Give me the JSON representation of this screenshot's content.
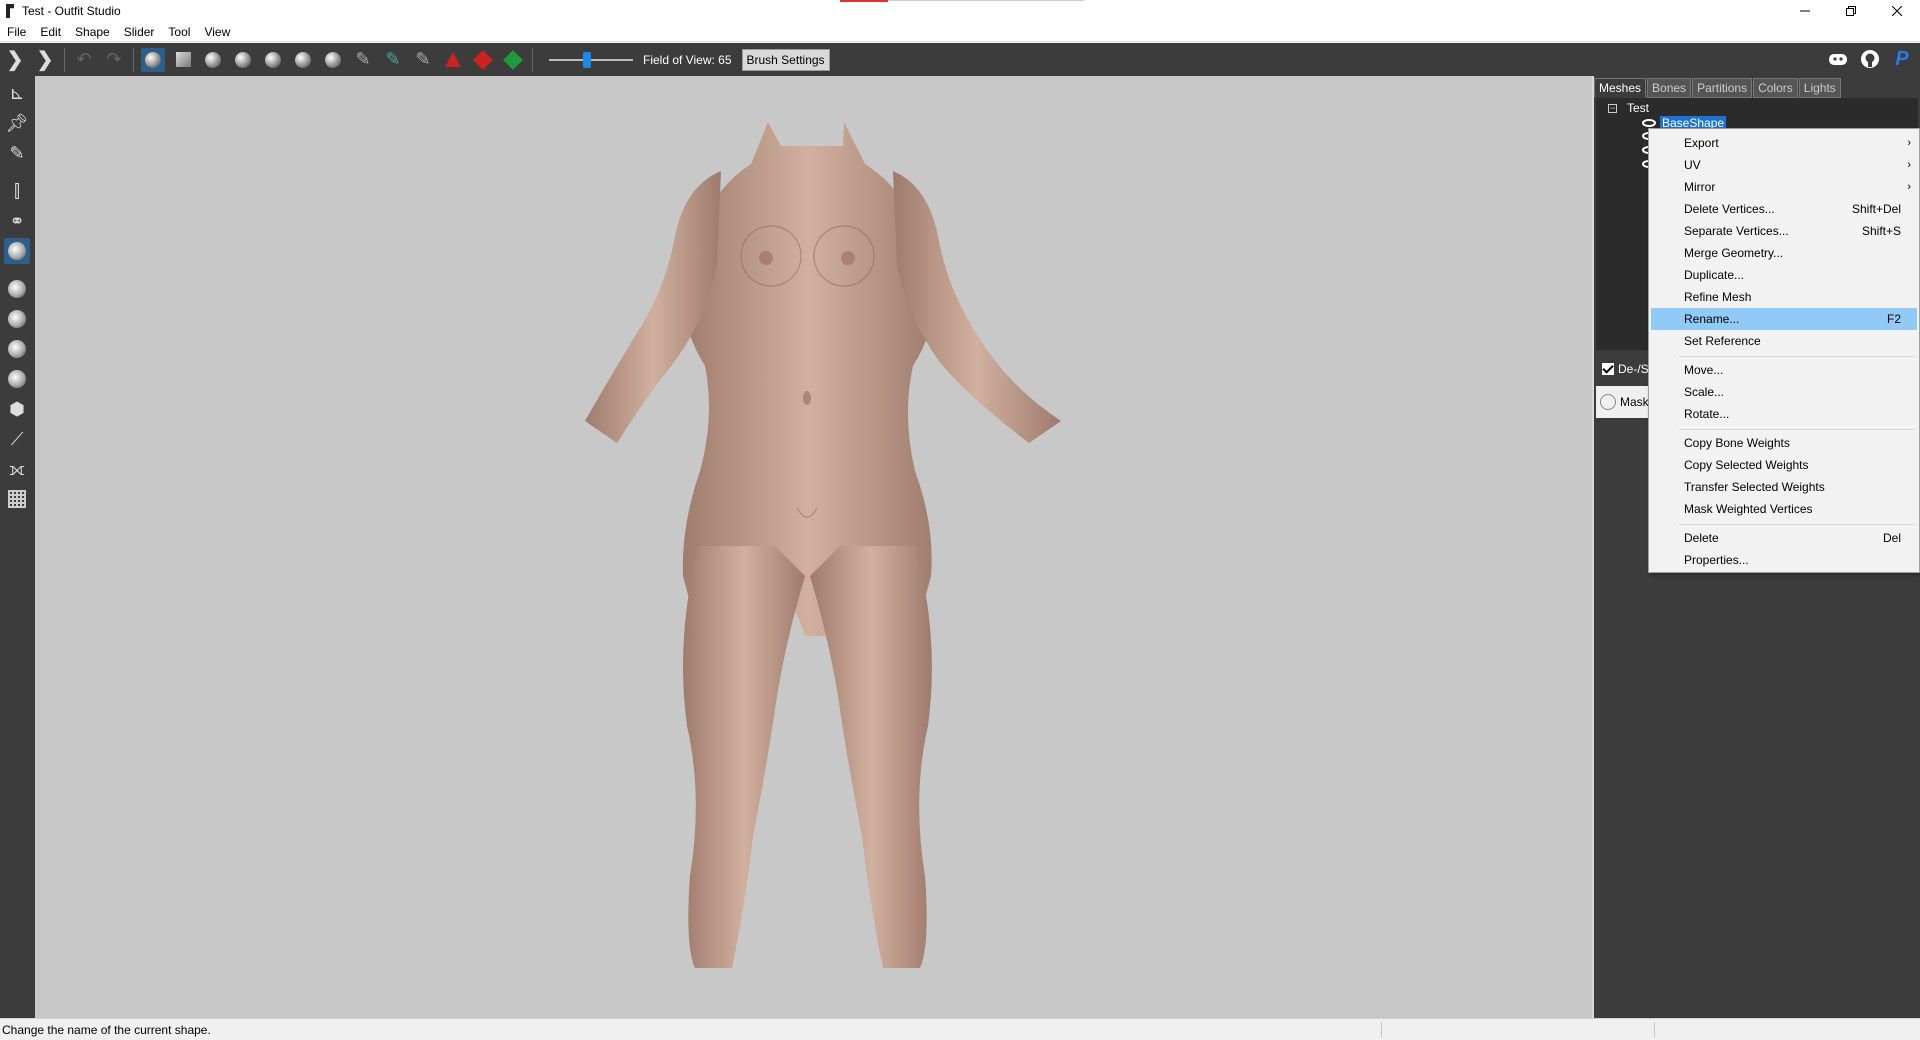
{
  "window": {
    "title": "Test - Outfit Studio",
    "controls": [
      "minimize-icon",
      "restore-icon",
      "close-icon"
    ]
  },
  "menubar": [
    "File",
    "Edit",
    "Shape",
    "Slider",
    "Tool",
    "View"
  ],
  "toolbar": {
    "fov_label": "Field of View: 65",
    "fov_value": 65,
    "brush_settings_label": "Brush Settings",
    "icons": [
      "view-toggle-icon",
      "view-next-icon",
      "undo-icon",
      "redo-icon",
      "select-brush-icon",
      "mask-brush-icon",
      "inflate-brush-icon",
      "deflate-brush-icon",
      "move-brush-icon",
      "smooth-brush-icon",
      "undiff-brush-icon",
      "color-brush-icon",
      "alpha-brush-icon",
      "weight-brush-icon",
      "collapse-vertex-icon",
      "flip-edge-icon",
      "split-edge-icon"
    ],
    "right_icons": [
      "discord-icon",
      "github-icon",
      "paypal-icon"
    ]
  },
  "left_tools": [
    "move-tool-icon",
    "pin-tool-icon",
    "pencil-tool-icon",
    "x-mirror-icon",
    "connected-only-icon",
    "global-brush-icon",
    "vertex-select-icon",
    "sphere-small-icon",
    "sphere-medium-icon",
    "sphere-large-icon",
    "cube-icon",
    "bone-icon",
    "bone-move-icon",
    "grid-icon"
  ],
  "right_panel": {
    "tabs": [
      "Meshes",
      "Bones",
      "Partitions",
      "Colors",
      "Lights"
    ],
    "active_tab": "Meshes",
    "tree": {
      "root": "Test",
      "selected_shape": "BaseShape"
    },
    "row2_label": "De-/S",
    "row3_label": "Mask"
  },
  "context_menu": {
    "items": [
      {
        "label": "Export",
        "submenu": true
      },
      {
        "label": "UV",
        "submenu": true
      },
      {
        "label": "Mirror",
        "submenu": true
      },
      {
        "label": "Delete Vertices...",
        "shortcut": "Shift+Del"
      },
      {
        "label": "Separate Vertices...",
        "shortcut": "Shift+S"
      },
      {
        "label": "Merge Geometry..."
      },
      {
        "label": "Duplicate..."
      },
      {
        "label": "Refine Mesh"
      },
      {
        "label": "Rename...",
        "shortcut": "F2",
        "highlighted": true
      },
      {
        "label": "Set Reference"
      },
      {
        "label": "Move..."
      },
      {
        "label": "Scale..."
      },
      {
        "label": "Rotate..."
      },
      {
        "label": "Copy Bone Weights"
      },
      {
        "label": "Copy Selected Weights"
      },
      {
        "label": "Transfer Selected Weights"
      },
      {
        "label": "Mask Weighted Vertices"
      },
      {
        "label": "Delete",
        "shortcut": "Del"
      },
      {
        "label": "Properties..."
      }
    ]
  },
  "statusbar": {
    "text": "Change the name of the current shape."
  },
  "colors": {
    "toolbar_bg": "#3c3c3c",
    "viewport_bg": "#c8c8c8",
    "highlight": "#91c9f7",
    "selection": "#1e73d2",
    "skin": "#c8a492"
  }
}
